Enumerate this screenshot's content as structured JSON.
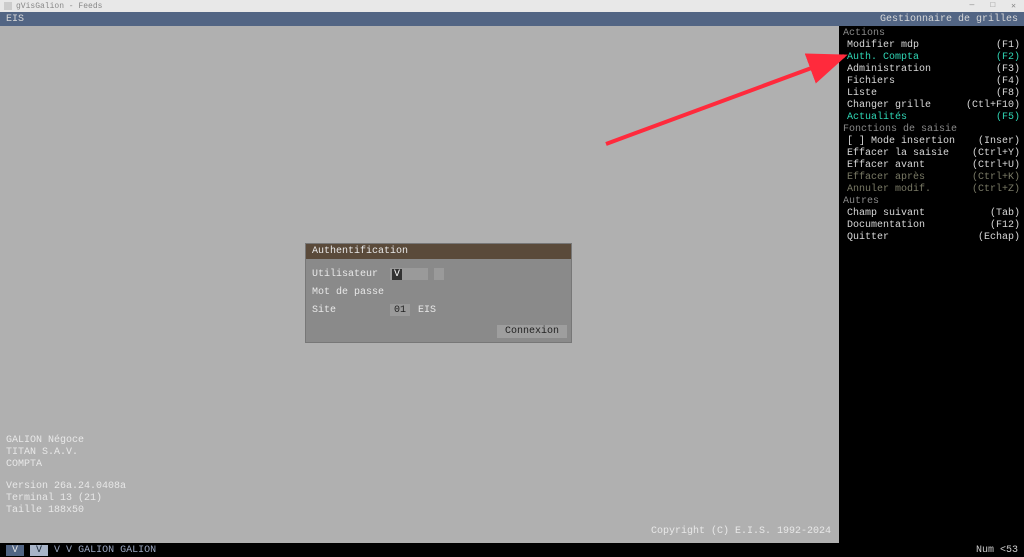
{
  "chrome": {
    "title": "gVisGalion - Feeds",
    "min": "—",
    "max": "□",
    "close": "✕"
  },
  "titlebar": {
    "left": "EIS",
    "right": "Gestionnaire de grilles"
  },
  "sidebar": {
    "sections": [
      {
        "heading": "Actions",
        "items": [
          {
            "label": "Modifier mdp",
            "key": "(F1)",
            "style": "normal"
          },
          {
            "label": "Auth. Compta",
            "key": "(F2)",
            "style": "highlight"
          },
          {
            "label": "Administration",
            "key": "(F3)",
            "style": "normal"
          },
          {
            "label": "Fichiers",
            "key": "(F4)",
            "style": "normal"
          },
          {
            "label": "Liste",
            "key": "(F8)",
            "style": "normal"
          },
          {
            "label": "Changer grille",
            "key": "(Ctl+F10)",
            "style": "normal"
          },
          {
            "label": "Actualités",
            "key": "(F5)",
            "style": "highlight"
          }
        ]
      },
      {
        "heading": "Fonctions de saisie",
        "items": [
          {
            "label": "[ ] Mode insertion",
            "key": "(Inser)",
            "style": "normal"
          },
          {
            "label": "Effacer la saisie",
            "key": "(Ctrl+Y)",
            "style": "normal"
          },
          {
            "label": "Effacer avant",
            "key": "(Ctrl+U)",
            "style": "normal"
          },
          {
            "label": "Effacer après",
            "key": "(Ctrl+K)",
            "style": "dim"
          },
          {
            "label": "Annuler modif.",
            "key": "(Ctrl+Z)",
            "style": "dim"
          }
        ]
      },
      {
        "heading": "Autres",
        "items": [
          {
            "label": "Champ suivant",
            "key": "(Tab)",
            "style": "normal"
          },
          {
            "label": "Documentation",
            "key": "(F12)",
            "style": "normal"
          },
          {
            "label": "Quitter",
            "key": "(Echap)",
            "style": "normal"
          }
        ]
      }
    ]
  },
  "auth": {
    "title": "Authentification",
    "user_label": "Utilisateur",
    "user_value": "V",
    "pass_label": "Mot de passe",
    "site_label": "Site",
    "site_code": "01",
    "site_name": "EIS",
    "connect": "Connexion"
  },
  "info": {
    "l1": "GALION Négoce",
    "l2": "TITAN  S.A.V.",
    "l3": "COMPTA",
    "l4": "Version 26a.24.0408a",
    "l5": "Terminal 13 (21)",
    "l6": "Taille 188x50"
  },
  "copyright": "Copyright (C) E.I.S. 1992-2024",
  "status": {
    "tags": [
      "V",
      "V",
      "V",
      "V",
      "GALION",
      "GALION"
    ],
    "right": "Num <53"
  }
}
